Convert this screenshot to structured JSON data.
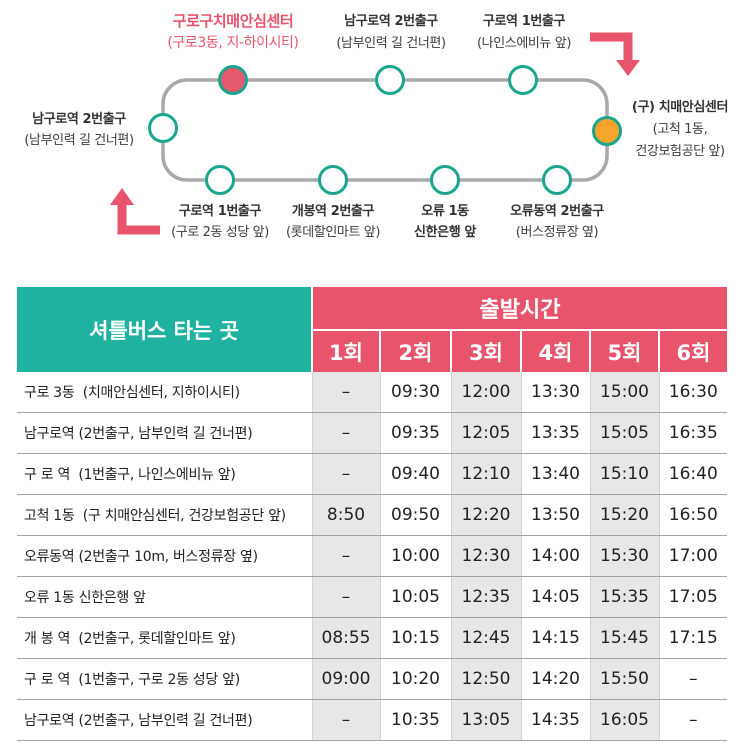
{
  "colors": {
    "accent": "#e8546b",
    "teal": "#1fb29f",
    "marker_ring": "#1aa58e",
    "highlight_stop": "#e35a6f",
    "old_center_stop": "#f5a42c",
    "route_line": "#a9a9a9",
    "shaded_column": "#e7e7e7"
  },
  "route_map": {
    "start_stop": {
      "name": "구로구치매안심센터",
      "detail": "(구로3동, 지-하이시티)"
    },
    "top_stops": [
      {
        "name": "남구로역 2번출구",
        "detail": "(남부인력 길 건너편)"
      },
      {
        "name": "구로역 1번출구",
        "detail": "(나인스에비뉴 앞)"
      }
    ],
    "right_stop": {
      "name": "(구) 치매안심센터",
      "detail_lines": [
        "(고척 1동,",
        "건강보험공단 앞)"
      ]
    },
    "bottom_stops": [
      {
        "name": "구로역 1번출구",
        "detail": "(구로 2동 성당 앞)"
      },
      {
        "name": "개봉역 2번출구",
        "detail": "(롯데할인마트 앞)"
      },
      {
        "name": "오류 1동",
        "detail": "신한은행 앞"
      },
      {
        "name": "오류동역 2번출구",
        "detail": "(버스정류장 옆)"
      }
    ],
    "left_stop": {
      "name": "남구로역 2번출구",
      "detail": "(남부인력 길 건너편)"
    }
  },
  "timetable": {
    "stop_column_header": "셔틀버스 타는 곳",
    "departure_header": "출발시간",
    "runs": [
      "1회",
      "2회",
      "3회",
      "4회",
      "5회",
      "6회"
    ],
    "rows": [
      {
        "stop": "구로 3동  (치매안심센터, 지하이시티)",
        "times": [
          "–",
          "09:30",
          "12:00",
          "13:30",
          "15:00",
          "16:30"
        ]
      },
      {
        "stop": "남구로역 (2번출구, 남부인력 길 건너편)",
        "times": [
          "–",
          "09:35",
          "12:05",
          "13:35",
          "15:05",
          "16:35"
        ]
      },
      {
        "stop": "구 로 역  (1번출구, 나인스에비뉴 앞)",
        "times": [
          "–",
          "09:40",
          "12:10",
          "13:40",
          "15:10",
          "16:40"
        ]
      },
      {
        "stop": "고척 1동  (구 치매안심센터, 건강보험공단 앞)",
        "times": [
          "8:50",
          "09:50",
          "12:20",
          "13:50",
          "15:20",
          "16:50"
        ]
      },
      {
        "stop": "오류동역 (2번출구 10m, 버스정류장 옆)",
        "times": [
          "–",
          "10:00",
          "12:30",
          "14:00",
          "15:30",
          "17:00"
        ]
      },
      {
        "stop": "오류 1동 신한은행 앞",
        "times": [
          "–",
          "10:05",
          "12:35",
          "14:05",
          "15:35",
          "17:05"
        ]
      },
      {
        "stop": "개 봉 역  (2번출구, 롯데할인마트 앞)",
        "times": [
          "08:55",
          "10:15",
          "12:45",
          "14:15",
          "15:45",
          "17:15"
        ]
      },
      {
        "stop": "구 로 역  (1번출구, 구로 2동 성당 앞)",
        "times": [
          "09:00",
          "10:20",
          "12:50",
          "14:20",
          "15:50",
          "–"
        ]
      },
      {
        "stop": "남구로역 (2번출구, 남부인력 길 건너편)",
        "times": [
          "–",
          "10:35",
          "13:05",
          "14:35",
          "16:05",
          "–"
        ]
      }
    ]
  }
}
